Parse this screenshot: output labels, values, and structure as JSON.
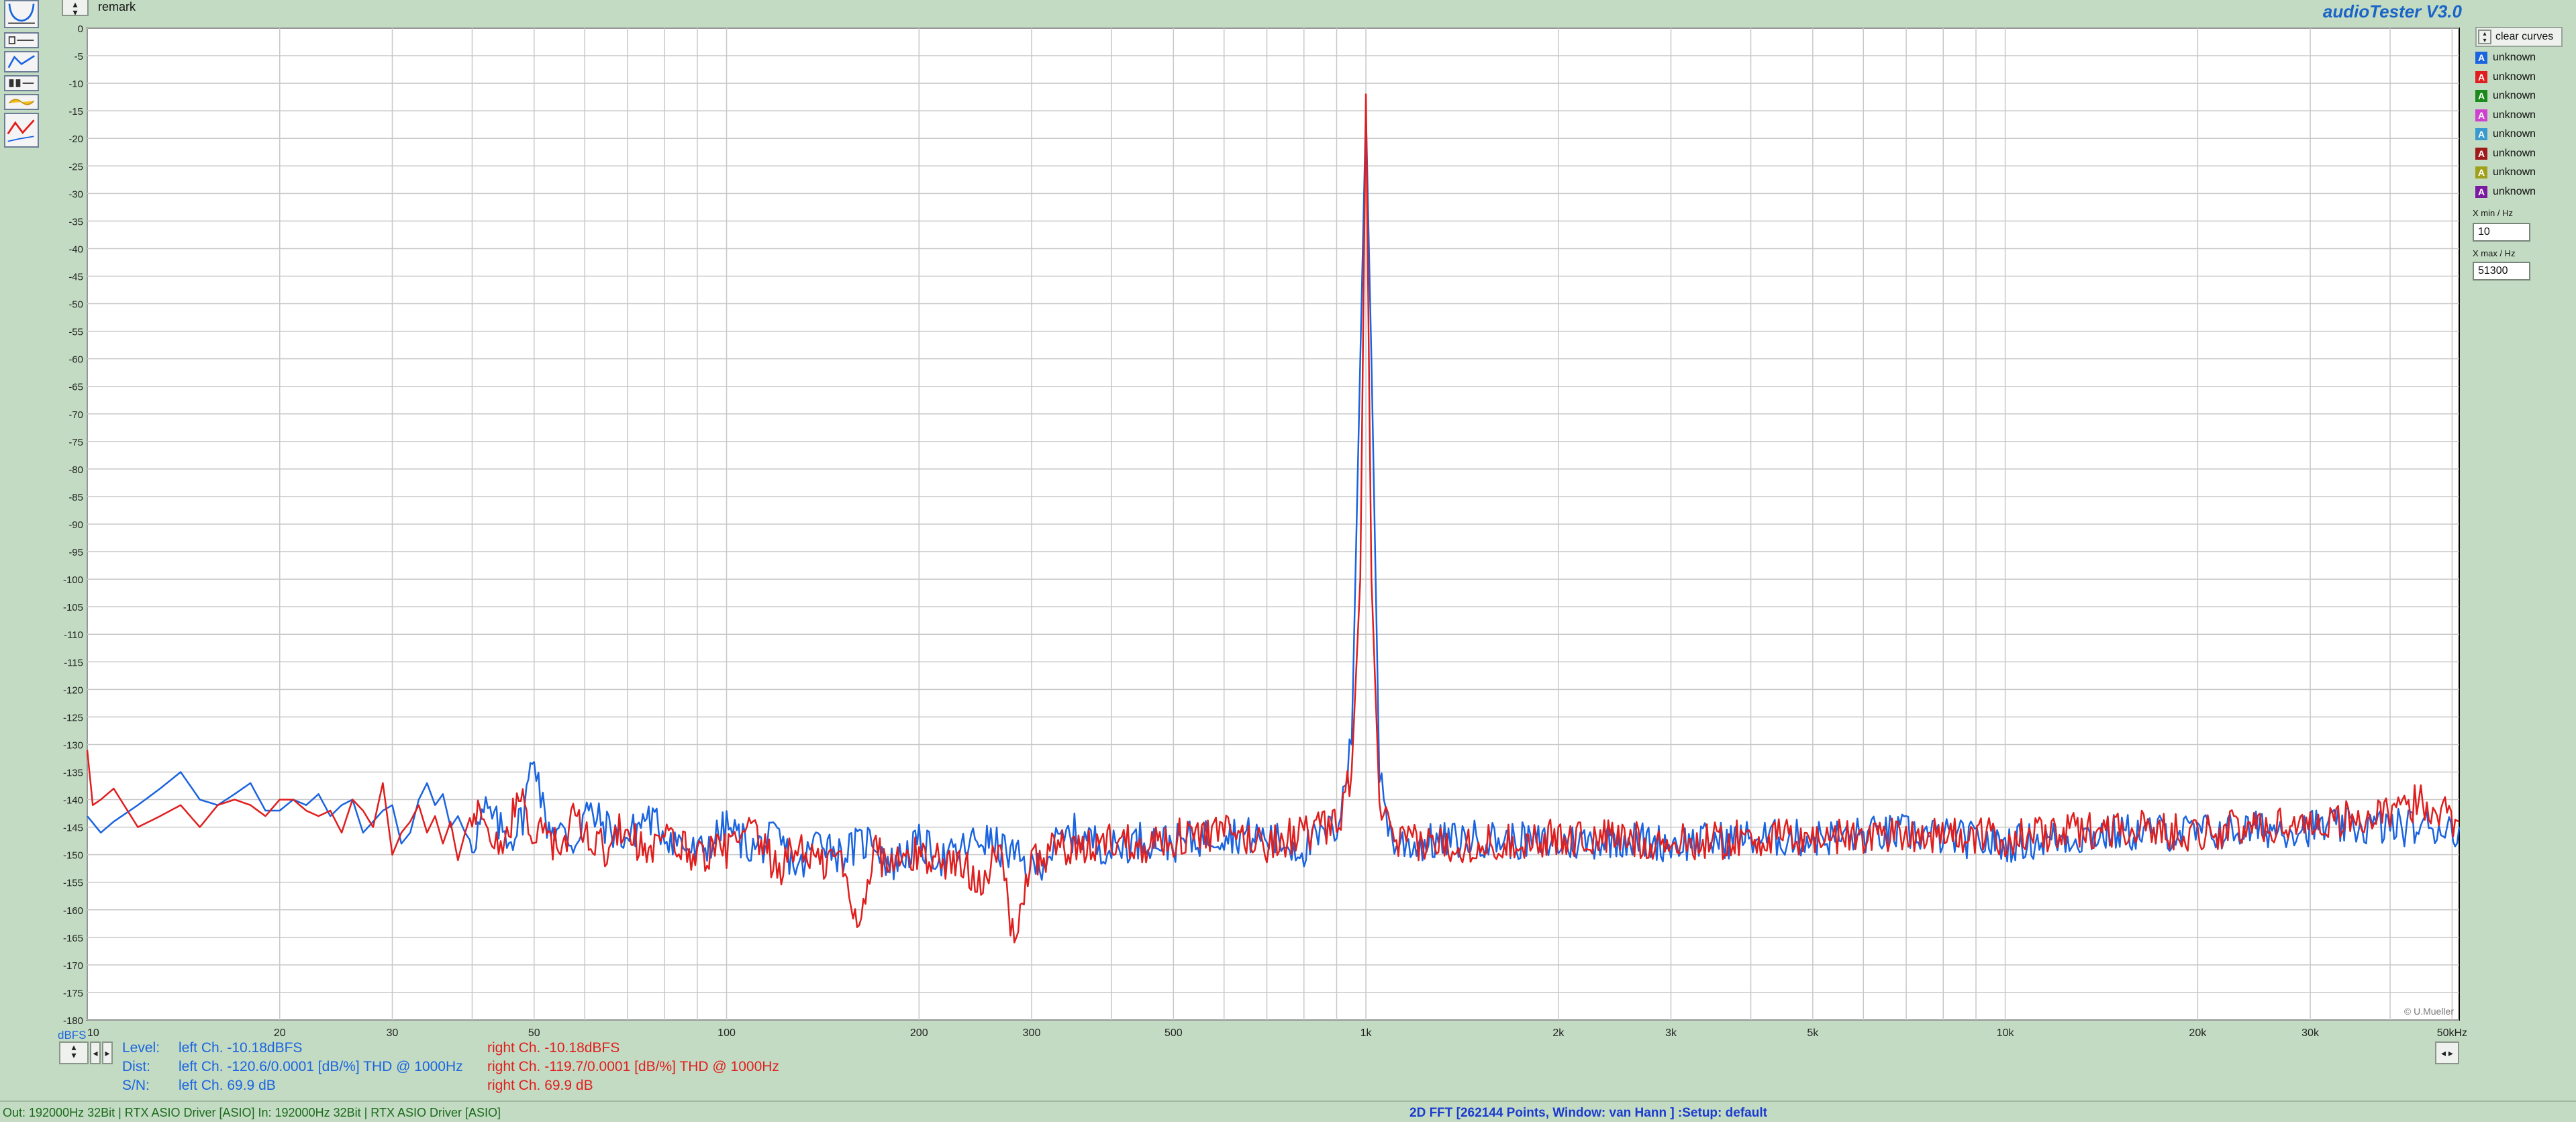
{
  "app_title": "audioTester  V3.0",
  "remark": "remark",
  "legend": {
    "clear_label": "clear curves",
    "items": [
      {
        "letter": "A",
        "label": "unknown",
        "color": "#1a64e0"
      },
      {
        "letter": "A",
        "label": "unknown",
        "color": "#e01e1e"
      },
      {
        "letter": "A",
        "label": "unknown",
        "color": "#1a8a1a"
      },
      {
        "letter": "A",
        "label": "unknown",
        "color": "#d040d0"
      },
      {
        "letter": "A",
        "label": "unknown",
        "color": "#3a9ad0"
      },
      {
        "letter": "A",
        "label": "unknown",
        "color": "#a01a1a"
      },
      {
        "letter": "A",
        "label": "unknown",
        "color": "#a0a01a"
      },
      {
        "letter": "A",
        "label": "unknown",
        "color": "#7a1aa0"
      }
    ]
  },
  "xrange": {
    "min_label": "X min / Hz",
    "min_value": "10",
    "max_label": "X max / Hz",
    "max_value": "51300"
  },
  "measurements": {
    "level_label": "Level:",
    "dist_label": "Dist:",
    "sn_label": "S/N:",
    "left_level": "left Ch. -10.18dBFS",
    "left_dist": "left Ch. -120.6/0.0001 [dB/%] THD @ 1000Hz",
    "left_sn": "left Ch. 69.9 dB",
    "right_level": "right Ch. -10.18dBFS",
    "right_dist": "right Ch. -119.7/0.0001 [dB/%] THD @ 1000Hz",
    "right_sn": "right Ch. 69.9 dB"
  },
  "status": {
    "left": "Out: 192000Hz 32Bit  | RTX ASIO Driver [ASIO]  In: 192000Hz 32Bit  | RTX ASIO Driver [ASIO]",
    "center": "2D FFT [262144 Points, Window: van Hann ]  :Setup:  default"
  },
  "chart_data": {
    "type": "line",
    "title": "",
    "xlabel": "",
    "ylabel": "dBFS",
    "x_scale": "log",
    "xlim": [
      10,
      51300
    ],
    "ylim": [
      -180,
      0
    ],
    "grid": true,
    "copyright": "© U.Mueller",
    "y_ticks": [
      0,
      -5,
      -10,
      -15,
      -20,
      -25,
      -30,
      -35,
      -40,
      -45,
      -50,
      -55,
      -60,
      -65,
      -70,
      -75,
      -80,
      -85,
      -90,
      -95,
      -100,
      -105,
      -110,
      -115,
      -120,
      -125,
      -130,
      -135,
      -140,
      -145,
      -150,
      -155,
      -160,
      -165,
      -170,
      -175,
      -180
    ],
    "x_ticks": [
      {
        "v": 10,
        "label": "10"
      },
      {
        "v": 20,
        "label": "20"
      },
      {
        "v": 30,
        "label": "30"
      },
      {
        "v": 50,
        "label": "50"
      },
      {
        "v": 100,
        "label": "100"
      },
      {
        "v": 200,
        "label": "200"
      },
      {
        "v": 300,
        "label": "300"
      },
      {
        "v": 500,
        "label": "500"
      },
      {
        "v": 1000,
        "label": "1k"
      },
      {
        "v": 2000,
        "label": "2k"
      },
      {
        "v": 3000,
        "label": "3k"
      },
      {
        "v": 5000,
        "label": "5k"
      },
      {
        "v": 10000,
        "label": "10k"
      },
      {
        "v": 20000,
        "label": "20k"
      },
      {
        "v": 30000,
        "label": "30k"
      },
      {
        "v": 50000,
        "label": "50kHz"
      }
    ],
    "series": [
      {
        "color": "#1a64e0",
        "x": [
          10,
          10.5,
          11,
          12,
          13,
          14,
          15,
          16,
          17,
          18,
          19,
          20,
          21,
          22,
          23,
          24,
          25,
          26,
          27,
          28,
          29,
          30,
          31,
          32,
          33,
          34,
          35,
          36,
          37,
          38,
          39,
          40,
          42,
          44,
          46,
          48,
          50,
          52,
          55,
          58,
          60,
          65,
          70,
          75,
          80,
          90,
          100,
          110,
          120,
          130,
          140,
          150,
          170,
          180,
          200,
          220,
          250,
          280,
          300,
          330,
          350,
          400,
          450,
          500,
          600,
          700,
          800,
          900,
          950,
          980,
          1000,
          1020,
          1050,
          1100,
          1200,
          1500,
          2000,
          2500,
          3000,
          4000,
          5000,
          7000,
          10000,
          15000,
          20000,
          30000,
          40000,
          51300
        ],
        "y": [
          -143,
          -146,
          -144,
          -141,
          -138,
          -135,
          -140,
          -141,
          -139,
          -137,
          -142,
          -142,
          -140,
          -141,
          -139,
          -143,
          -141,
          -140,
          -146,
          -144,
          -142,
          -141,
          -148,
          -146,
          -140,
          -137,
          -141,
          -139,
          -145,
          -143,
          -146,
          -148,
          -142,
          -145,
          -147,
          -143,
          -131,
          -144,
          -146,
          -148,
          -142,
          -145,
          -147,
          -143,
          -146,
          -150,
          -145,
          -149,
          -147,
          -153,
          -146,
          -150,
          -147,
          -152,
          -148,
          -151,
          -147,
          -150,
          -153,
          -148,
          -146,
          -149,
          -147,
          -148,
          -146,
          -147,
          -149,
          -145,
          -130,
          -60,
          -15,
          -60,
          -135,
          -148,
          -148,
          -147,
          -148,
          -147,
          -148,
          -147,
          -147,
          -146,
          -148,
          -146,
          -146,
          -145,
          -145,
          -145
        ]
      },
      {
        "color": "#e01e1e",
        "x": [
          10,
          10.2,
          10.5,
          11,
          12,
          13,
          14,
          15,
          16,
          17,
          18,
          19,
          20,
          21,
          22,
          23,
          24,
          25,
          26,
          27,
          28,
          29,
          30,
          31,
          32,
          33,
          34,
          35,
          36,
          37,
          38,
          39,
          40,
          42,
          44,
          46,
          48,
          50,
          52,
          55,
          58,
          60,
          65,
          70,
          75,
          80,
          90,
          100,
          110,
          120,
          130,
          140,
          150,
          160,
          170,
          180,
          200,
          220,
          250,
          270,
          280,
          300,
          330,
          350,
          400,
          450,
          500,
          600,
          700,
          800,
          900,
          950,
          980,
          1000,
          1020,
          1050,
          1100,
          1200,
          1500,
          2000,
          2500,
          3000,
          4000,
          5000,
          7000,
          10000,
          15000,
          20000,
          30000,
          40000,
          45000,
          51300
        ],
        "y": [
          -131,
          -141,
          -140,
          -138,
          -145,
          -143,
          -141,
          -145,
          -141,
          -140,
          -141,
          -143,
          -140,
          -140,
          -142,
          -143,
          -142,
          -146,
          -140,
          -142,
          -145,
          -137,
          -150,
          -146,
          -144,
          -141,
          -146,
          -143,
          -148,
          -144,
          -151,
          -146,
          -142,
          -145,
          -150,
          -144,
          -138,
          -148,
          -145,
          -150,
          -143,
          -146,
          -149,
          -144,
          -151,
          -147,
          -150,
          -149,
          -146,
          -153,
          -148,
          -152,
          -150,
          -163,
          -149,
          -152,
          -150,
          -151,
          -154,
          -150,
          -165,
          -152,
          -148,
          -150,
          -147,
          -148,
          -147,
          -146,
          -148,
          -146,
          -145,
          -135,
          -100,
          -12,
          -100,
          -140,
          -148,
          -148,
          -148,
          -147,
          -147,
          -148,
          -147,
          -147,
          -146,
          -147,
          -145,
          -146,
          -144,
          -143,
          -140,
          -144
        ]
      }
    ]
  }
}
